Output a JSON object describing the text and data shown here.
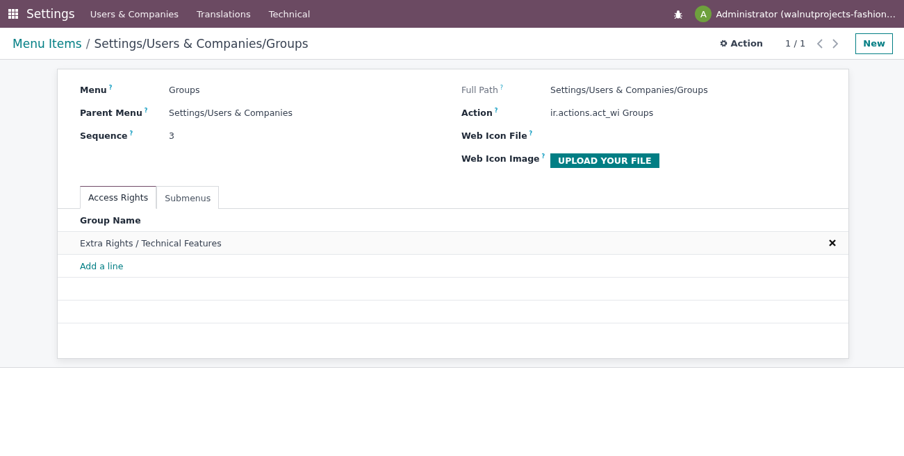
{
  "navbar": {
    "app": "Settings",
    "menus": [
      "Users & Companies",
      "Translations",
      "Technical"
    ],
    "avatar": "A",
    "user": "Administrator (walnutprojects-fashion…"
  },
  "breadcrumb": {
    "parent": "Menu Items",
    "separator": "/",
    "current": "Settings/Users & Companies/Groups"
  },
  "controls": {
    "action": "Action",
    "pager": "1 / 1",
    "new": "New"
  },
  "left_fields": [
    {
      "label": "Menu",
      "help": "?",
      "value": "Groups",
      "kind": "text",
      "muted": false
    },
    {
      "label": "Parent Menu",
      "help": "?",
      "value": "Settings/Users & Companies",
      "kind": "text",
      "muted": false
    },
    {
      "label": "Sequence",
      "help": "?",
      "value": "3",
      "kind": "text",
      "muted": false
    }
  ],
  "right_fields": [
    {
      "label": "Full Path",
      "help": "?",
      "value": "Settings/Users & Companies/Groups",
      "kind": "text",
      "muted": true
    },
    {
      "label": "Action",
      "help": "?",
      "value": "ir.actions.act_wi Groups",
      "kind": "text",
      "muted": false
    },
    {
      "label": "Web Icon File",
      "help": "?",
      "kind": "empty",
      "muted": false
    },
    {
      "label": "Web Icon Image",
      "help": "?",
      "value": "UPLOAD YOUR FILE",
      "kind": "upload",
      "muted": false
    }
  ],
  "tabs": [
    {
      "label": "Access Rights",
      "selected": true
    },
    {
      "label": "Submenus",
      "selected": false
    }
  ],
  "table": {
    "column": "Group Name",
    "rows": [
      {
        "name": "Extra Rights / Technical Features"
      }
    ],
    "add_line": "Add a line"
  }
}
